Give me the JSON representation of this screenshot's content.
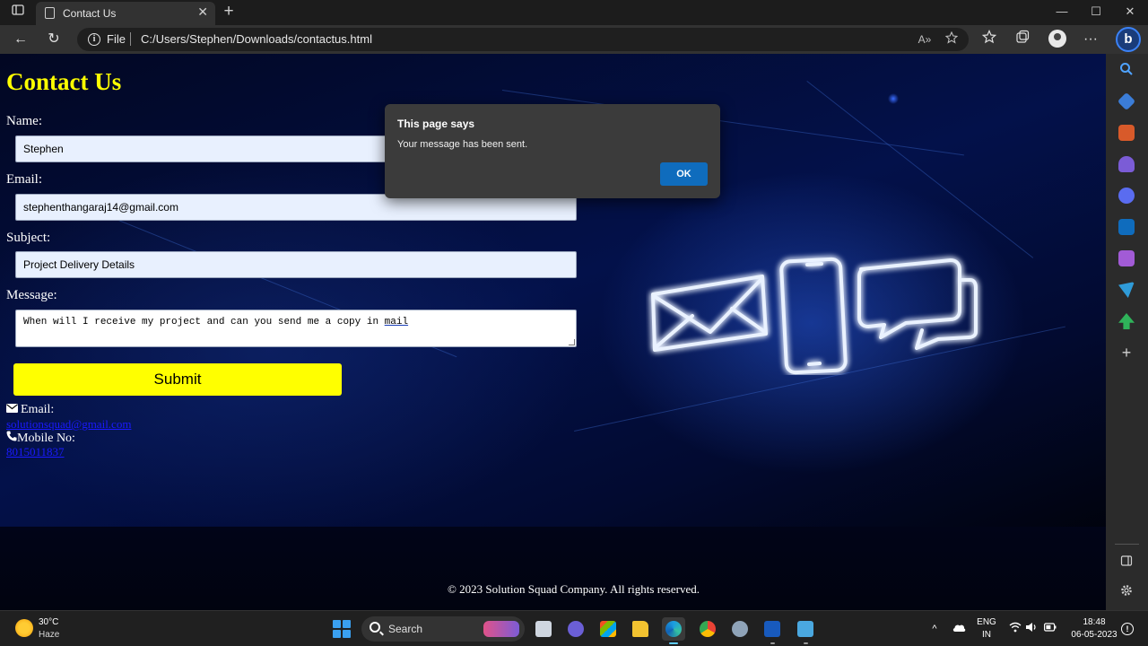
{
  "browser": {
    "tab_title": "Contact Us",
    "close_glyph": "✕",
    "new_tab_glyph": "+",
    "minimize_glyph": "—",
    "maximize_glyph": "☐",
    "window_close_glyph": "✕",
    "back_glyph": "←",
    "refresh_glyph": "↻",
    "info_glyph": "i",
    "scheme_label": "File",
    "url": "C:/Users/Stephen/Downloads/contactus.html",
    "read_aloud_glyph": "A»",
    "more_glyph": "···",
    "bing_glyph": "b"
  },
  "page": {
    "title": "Contact Us",
    "name_label": "Name:",
    "name_value": "Stephen",
    "email_label": "Email:",
    "email_value": "stephenthangaraj14@gmail.com",
    "subject_label": "Subject:",
    "subject_value": "Project Delivery Details",
    "message_label": "Message:",
    "message_value_pre": "When will I receive my project and can you send me a copy in ",
    "message_value_word": "mail",
    "submit_label": "Submit",
    "contact_email_label": "Email:",
    "contact_email_value": "solutionsquad@gmail.com",
    "contact_mobile_label": "Mobile No:",
    "contact_mobile_value": "8015011837",
    "copyright": "© 2023 Solution Squad Company. All rights reserved."
  },
  "dialog": {
    "title": "This page says",
    "message": "Your message has been sent.",
    "ok_label": "OK"
  },
  "taskbar": {
    "weather_temp": "30°C",
    "weather_condition": "Haze",
    "search_label": "Search",
    "language": "ENG",
    "region": "IN",
    "time": "18:48",
    "date": "06-05-2023",
    "tray_chevron_glyph": "^",
    "notification_glyph": "!",
    "apps": [
      "file-explorer-view",
      "teams",
      "store",
      "file-explorer",
      "edge",
      "chrome",
      "settings",
      "word",
      "notepad"
    ]
  },
  "colors": {
    "accent_yellow": "#ffff00",
    "link_blue": "#1a1aff",
    "dialog_ok": "#0f6cbd",
    "neon_blue": "#4f8dff"
  }
}
